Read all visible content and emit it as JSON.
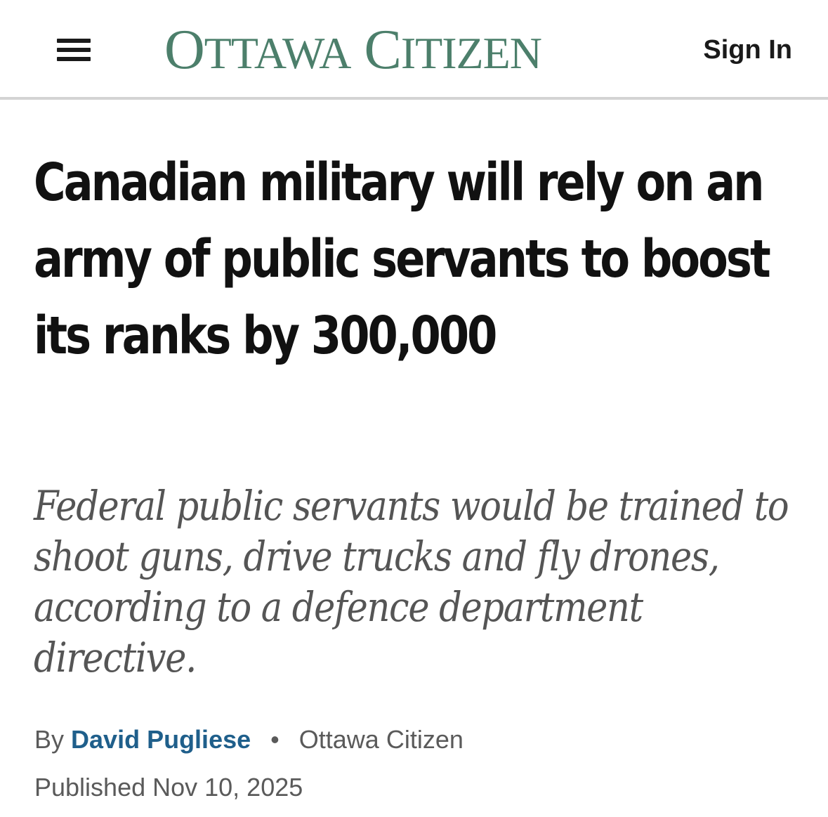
{
  "header": {
    "menu_icon": "hamburger-menu-icon",
    "logo_text": "Ottawa Citizen",
    "logo_color": "#4c7f6b",
    "sign_in_label": "Sign In"
  },
  "article": {
    "headline": "Canadian military will rely on an army of public servants to boost its ranks by 300,000",
    "dek": "Federal public servants would be trained to shoot guns, drive trucks and fly drones, according to a defence department directive.",
    "byline_prefix": "By",
    "author": "David Pugliese",
    "separator": "•",
    "outlet": "Ottawa Citizen",
    "published": "Published Nov 10, 2025"
  }
}
